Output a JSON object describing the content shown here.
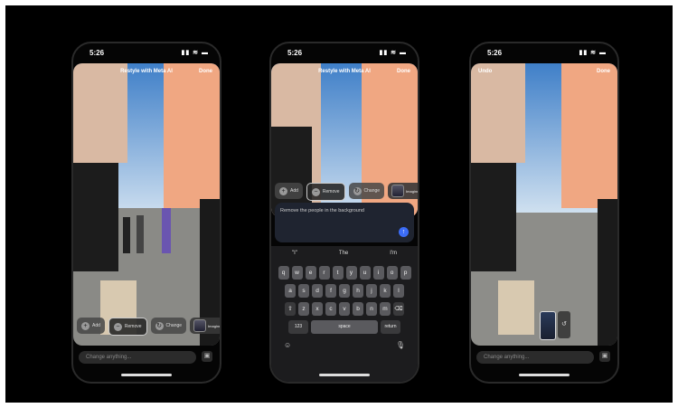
{
  "status": {
    "time": "5:26",
    "icons": "▮▮ ≋ ▬"
  },
  "phone1": {
    "title": "Restyle with Meta AI",
    "done": "Done",
    "chips": [
      "Add",
      "Remove",
      "Change"
    ],
    "avatar_label": "Imagine",
    "input_placeholder": "Change anything..."
  },
  "phone2": {
    "title": "Restyle with Meta AI",
    "done": "Done",
    "chips": [
      "Add",
      "Remove",
      "Change"
    ],
    "avatar_label": "Imagine",
    "prompt_text": "Remove the people in the background",
    "suggestions": [
      "\"I\"",
      "The",
      "I'm"
    ],
    "row1": [
      "q",
      "w",
      "e",
      "r",
      "t",
      "y",
      "u",
      "i",
      "o",
      "p"
    ],
    "row2": [
      "a",
      "s",
      "d",
      "f",
      "g",
      "h",
      "j",
      "k",
      "l"
    ],
    "row3": [
      "z",
      "x",
      "c",
      "v",
      "b",
      "n",
      "m"
    ],
    "key_123": "123",
    "key_space": "space",
    "key_return": "return"
  },
  "phone3": {
    "undo": "Undo",
    "done": "Done",
    "input_placeholder": "Change anything..."
  }
}
